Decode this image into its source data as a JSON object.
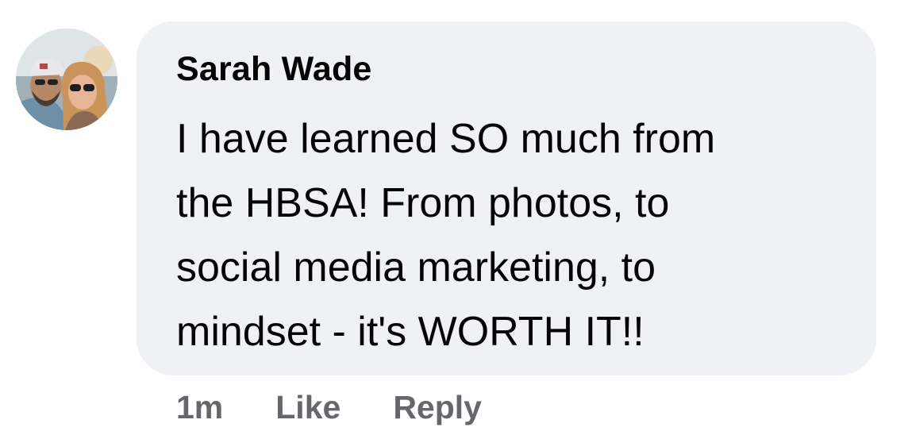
{
  "comment": {
    "author": "Sarah Wade",
    "text_lines": [
      "I have learned SO much from",
      "the HBSA! From photos, to",
      "social media marketing, to",
      "mindset - it's WORTH IT!!"
    ],
    "timestamp": "1m",
    "like_label": "Like",
    "reply_label": "Reply"
  },
  "colors": {
    "bubble_bg": "#f0f1f5",
    "text": "#050505",
    "secondary_text": "#65676b"
  },
  "icons": {
    "avatar": "profile-photo-couple"
  }
}
